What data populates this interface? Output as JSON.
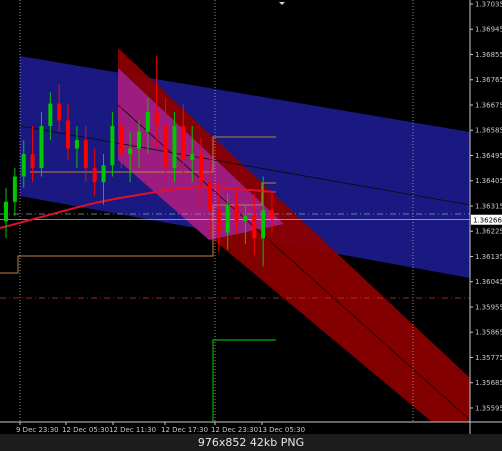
{
  "chart_data": {
    "type": "candlestick",
    "ylim": [
      1.35545,
      1.37035
    ],
    "y_ticks": [
      {
        "value": 1.37035,
        "label": "1.37035"
      },
      {
        "value": 1.36945,
        "label": "1.36945"
      },
      {
        "value": 1.36855,
        "label": "1.36855"
      },
      {
        "value": 1.36765,
        "label": "1.36765"
      },
      {
        "value": 1.36675,
        "label": "1.36675"
      },
      {
        "value": 1.36585,
        "label": "1.36585"
      },
      {
        "value": 1.36495,
        "label": "1.36495"
      },
      {
        "value": 1.36405,
        "label": "1.36405"
      },
      {
        "value": 1.36315,
        "label": "1.36315"
      },
      {
        "value": 1.36225,
        "label": "1.36225"
      },
      {
        "value": 1.36135,
        "label": "1.36135"
      },
      {
        "value": 1.36045,
        "label": "1.36045"
      },
      {
        "value": 1.35955,
        "label": "1.35955"
      },
      {
        "value": 1.35865,
        "label": "1.35865"
      },
      {
        "value": 1.35775,
        "label": "1.35775"
      },
      {
        "value": 1.35685,
        "label": "1.35685"
      },
      {
        "value": 1.35595,
        "label": "1.35595"
      }
    ],
    "x_ticks": [
      "9 Dec 23:30",
      "12 Dec 05:30",
      "12 Dec 11:30",
      "12 Dec 17:30",
      "12 Dec 23:30",
      "13 Dec 05:30"
    ],
    "current_price_label": "1.36266",
    "candles": [
      {
        "o": 1.3626,
        "h": 1.3638,
        "l": 1.362,
        "c": 1.3633
      },
      {
        "o": 1.3633,
        "h": 1.3645,
        "l": 1.3628,
        "c": 1.3642
      },
      {
        "o": 1.3642,
        "h": 1.3655,
        "l": 1.3638,
        "c": 1.365
      },
      {
        "o": 1.365,
        "h": 1.366,
        "l": 1.364,
        "c": 1.3645
      },
      {
        "o": 1.3645,
        "h": 1.3665,
        "l": 1.3642,
        "c": 1.366
      },
      {
        "o": 1.366,
        "h": 1.3672,
        "l": 1.3655,
        "c": 1.3668
      },
      {
        "o": 1.3668,
        "h": 1.3675,
        "l": 1.3658,
        "c": 1.3662
      },
      {
        "o": 1.3662,
        "h": 1.3668,
        "l": 1.3648,
        "c": 1.3652
      },
      {
        "o": 1.3652,
        "h": 1.366,
        "l": 1.3645,
        "c": 1.3655
      },
      {
        "o": 1.3655,
        "h": 1.366,
        "l": 1.364,
        "c": 1.3645
      },
      {
        "o": 1.3645,
        "h": 1.3652,
        "l": 1.3635,
        "c": 1.364
      },
      {
        "o": 1.364,
        "h": 1.365,
        "l": 1.3632,
        "c": 1.3646
      },
      {
        "o": 1.3646,
        "h": 1.3665,
        "l": 1.3642,
        "c": 1.366
      },
      {
        "o": 1.366,
        "h": 1.3668,
        "l": 1.3645,
        "c": 1.365
      },
      {
        "o": 1.365,
        "h": 1.3658,
        "l": 1.364,
        "c": 1.3652
      },
      {
        "o": 1.3652,
        "h": 1.3662,
        "l": 1.3645,
        "c": 1.3658
      },
      {
        "o": 1.3658,
        "h": 1.367,
        "l": 1.365,
        "c": 1.3665
      },
      {
        "o": 1.3665,
        "h": 1.3685,
        "l": 1.3652,
        "c": 1.366
      },
      {
        "o": 1.366,
        "h": 1.367,
        "l": 1.364,
        "c": 1.3645
      },
      {
        "o": 1.3645,
        "h": 1.3665,
        "l": 1.364,
        "c": 1.366
      },
      {
        "o": 1.366,
        "h": 1.3668,
        "l": 1.3642,
        "c": 1.3648
      },
      {
        "o": 1.3648,
        "h": 1.366,
        "l": 1.364,
        "c": 1.365
      },
      {
        "o": 1.365,
        "h": 1.3656,
        "l": 1.3632,
        "c": 1.364
      },
      {
        "o": 1.364,
        "h": 1.365,
        "l": 1.362,
        "c": 1.363
      },
      {
        "o": 1.363,
        "h": 1.364,
        "l": 1.3615,
        "c": 1.3622
      },
      {
        "o": 1.3622,
        "h": 1.3636,
        "l": 1.3616,
        "c": 1.3632
      },
      {
        "o": 1.3632,
        "h": 1.3638,
        "l": 1.3622,
        "c": 1.3626
      },
      {
        "o": 1.3626,
        "h": 1.3632,
        "l": 1.3618,
        "c": 1.3628
      },
      {
        "o": 1.3628,
        "h": 1.3636,
        "l": 1.3614,
        "c": 1.362
      },
      {
        "o": 1.362,
        "h": 1.3642,
        "l": 1.361,
        "c": 1.363
      },
      {
        "o": 1.363,
        "h": 1.3636,
        "l": 1.3622,
        "c": 1.3627
      }
    ],
    "colors": {
      "background": "#000000",
      "bull": "#00c800",
      "bear": "#ff0000",
      "blue_channel": "#1b1b8c",
      "red_channel": "#8a0000",
      "magenta_overlap": "#9e1e86",
      "moving_average": "#e0102a",
      "level_line": "#c08040",
      "green_level": "#00b000",
      "dashed_red": "#c83232",
      "dashed_cyan": "#7ca0b8",
      "grid": "#c8c8c8",
      "label_box": "#ffffff"
    }
  },
  "footer": {
    "text": "976x852  42kb  PNG"
  }
}
